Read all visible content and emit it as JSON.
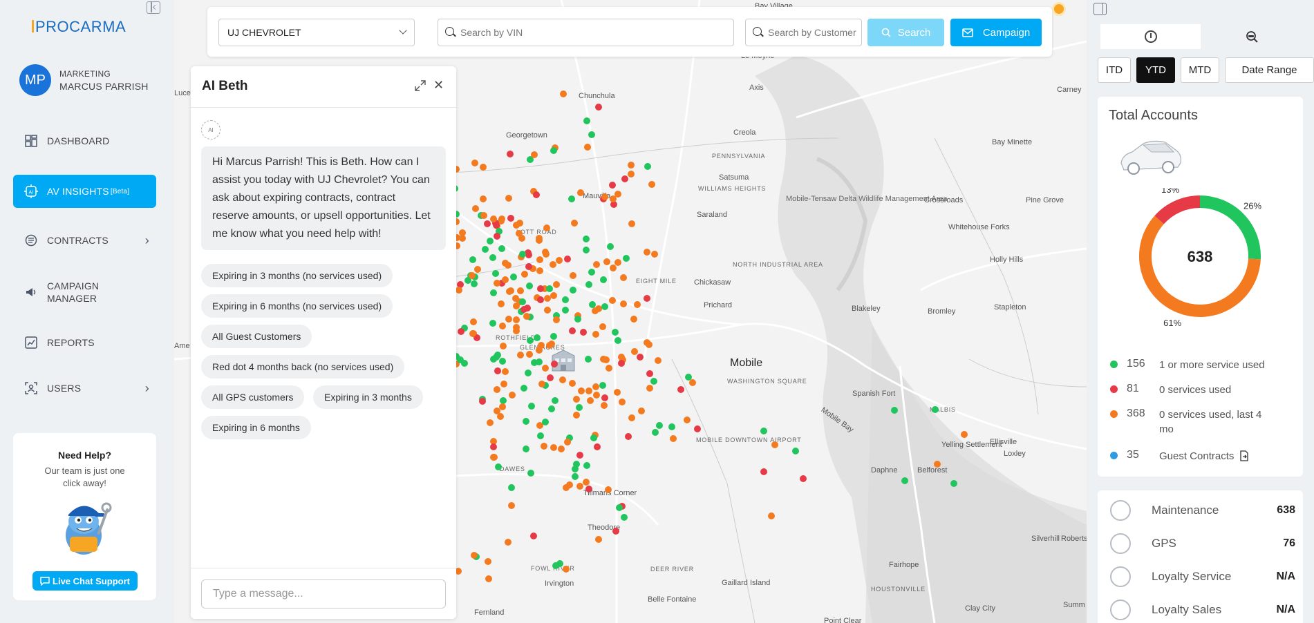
{
  "brand": {
    "logo_text": "PROCARMA",
    "accent": "#00a9f4"
  },
  "user": {
    "initials": "MP",
    "role": "MARKETING",
    "name": "MARCUS PARRISH"
  },
  "sidebar": {
    "items": [
      {
        "label": "DASHBOARD",
        "icon": "dashboard-icon"
      },
      {
        "label": "AV INSIGHTS",
        "badge": "[Beta]",
        "icon": "ai-icon",
        "active": true
      },
      {
        "label": "CONTRACTS",
        "icon": "contracts-icon",
        "has_arrow": true
      },
      {
        "label_line1": "CAMPAIGN",
        "label_line2": "MANAGER",
        "icon": "megaphone-icon"
      },
      {
        "label": "REPORTS",
        "icon": "reports-icon"
      },
      {
        "label": "USERS",
        "icon": "users-icon",
        "has_arrow": true
      }
    ],
    "help": {
      "title": "Need Help?",
      "subtitle_line1": "Our team is just one",
      "subtitle_line2": "click away!",
      "button": "Live Chat Support"
    }
  },
  "topbar": {
    "dealer": "UJ CHEVROLET",
    "vin_placeholder": "Search by VIN",
    "customer_placeholder": "Search by Customer",
    "search_label": "Search",
    "campaign_label": "Campaign"
  },
  "chat": {
    "title": "AI Beth",
    "ai_badge": "AI",
    "greeting": "Hi Marcus Parrish! This is Beth. How can I assist you today with UJ Chevrolet? You can ask about expiring contracts, contract reserve amounts, or upsell opportunities. Let me know what you need help with!",
    "suggestions": [
      "Expiring in 3 months (no services used)",
      "Expiring in 6 months (no services used)",
      "All Guest Customers",
      "Red dot 4 months back (no services used)",
      "All GPS customers",
      "Expiring in 3 months",
      "Expiring in 6 months"
    ],
    "input_placeholder": "Type a message..."
  },
  "map": {
    "labels": {
      "chunchula": "Chunchula",
      "georgetown": "Georgetown",
      "mauvilla": "Mauvilla",
      "creola": "Creola",
      "axis": "Axis",
      "pennsylvania": "PENNSYLVANIA",
      "satsuma": "Satsuma",
      "williams_heights": "WILLIAMS HEIGHTS",
      "saraland": "Saraland",
      "lott_road": "LOTT ROAD",
      "eight_mile": "EIGHT MILE",
      "chickasaw": "Chickasaw",
      "north_industrial": "NORTH INDUSTRIAL AREA",
      "prichard": "Prichard",
      "mobile": "Mobile",
      "washington_square": "WASHINGTON SQUARE",
      "glen_acres": "GLEN ACRES",
      "rothfield": "ROTHFIELD",
      "tillmans_corner": "Tillmans Corner",
      "theodore": "Theodore",
      "fowl_river": "FOWL RIVER",
      "irvington": "Irvington",
      "deer_river": "DEER RIVER",
      "belle_fontaine": "Belle Fontaine",
      "fernland": "Fernland",
      "mobile_downtown_airport": "MOBILE DOWNTOWN AIRPORT",
      "dawes": "DAWES",
      "delta": "Mobile-Tensaw Delta Wildlife Management Area",
      "crossroads": "Crossroads",
      "whitehouse_forks": "Whitehouse Forks",
      "pine_grove": "Pine Grove",
      "bay_minette": "Bay Minette",
      "carney": "Carney",
      "holly_hills": "Holly Hills",
      "blakeley": "Blakeley",
      "bromley": "Bromley",
      "stapleton": "Stapleton",
      "spanish_fort": "Spanish Fort",
      "malbis": "MALBIS",
      "mobile_bay": "Mobile Bay",
      "yelling_settlement": "Yelling Settlement",
      "ellisville": "Ellisville",
      "loxley": "Loxley",
      "daphne": "Daphne",
      "belforest": "Belforest",
      "silverhill": "Silverhill",
      "roberts": "Roberts",
      "fairhope": "Fairhope",
      "houstonville": "HOUSTONVILLE",
      "gaillard_island": "Gaillard Island",
      "clay_city": "Clay City",
      "lucedale": "Luce",
      "ame": "Ame",
      "le_moyne": "Le Moyne",
      "bay_village": "Bay Village",
      "summ": "Summ",
      "point_clear": "Point Clear"
    }
  },
  "right": {
    "ranges": [
      "ITD",
      "YTD",
      "MTD",
      "Date Range"
    ],
    "active_range": "YTD",
    "total_title": "Total Accounts",
    "total": "638",
    "donut": [
      {
        "label": "1 or more service used",
        "count": 156,
        "pct": "26%",
        "color": "#21c55d"
      },
      {
        "label": "0 services used, last 4 mo",
        "count": 368,
        "pct": "61%",
        "color": "#f47a1f"
      },
      {
        "label": "0 services used",
        "count": 81,
        "pct": "13%",
        "color": "#e63a46"
      }
    ],
    "legend": [
      {
        "count": "156",
        "label": "1 or more service used",
        "color": "#21c55d"
      },
      {
        "count": "81",
        "label": "0 services used",
        "color": "#e63a46"
      },
      {
        "count": "368",
        "label": "0 services used, last 4 mo",
        "color": "#f47a1f"
      },
      {
        "count": "35",
        "label": "Guest Contracts",
        "color": "#2f9be0"
      }
    ],
    "services": [
      {
        "label": "Maintenance",
        "value": "638"
      },
      {
        "label": "GPS",
        "value": "76"
      },
      {
        "label": "Loyalty Service",
        "value": "N/A"
      },
      {
        "label": "Loyalty Sales",
        "value": "N/A"
      }
    ]
  }
}
